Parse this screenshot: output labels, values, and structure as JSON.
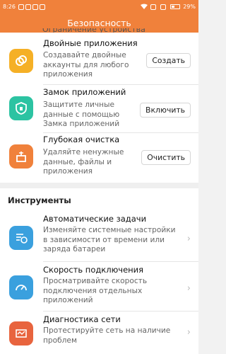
{
  "status": {
    "time": "8:26",
    "battery": "29%"
  },
  "header": {
    "title": "Безопасность"
  },
  "partial_text": "Ограничение устройства",
  "security_items": [
    {
      "title": "Двойные приложения",
      "desc": [
        "Создавайте двойные",
        "аккаунты для любого",
        "приложения"
      ],
      "button": "Создать",
      "icon": "dual-apps-icon",
      "color": "#f5b026"
    },
    {
      "title": "Замок приложений",
      "desc": [
        "Защитите личные",
        "данные с помощью",
        "Замка приложений"
      ],
      "button": "Включить",
      "icon": "app-lock-icon",
      "color": "#2cc3a2"
    },
    {
      "title": "Глубокая очистка",
      "desc": [
        "Удаляйте ненужные",
        "данные, файлы и",
        "приложения"
      ],
      "button": "Очистить",
      "icon": "deep-clean-icon",
      "color": "#f0813b"
    }
  ],
  "tools": {
    "heading": "Инструменты",
    "items": [
      {
        "title": "Автоматические задачи",
        "desc": [
          "Изменяйте системные настройки",
          "в зависимости от времени или",
          "заряда батареи"
        ],
        "icon": "auto-tasks-icon",
        "color": "#3aa0de"
      },
      {
        "title": "Скорость подключения",
        "desc": [
          "Просматривайте скорость",
          "подключения отдельных",
          "приложений"
        ],
        "icon": "speedometer-icon",
        "color": "#3aa0de"
      },
      {
        "title": "Диагностика сети",
        "desc": [
          "Протестируйте сеть на наличие",
          "проблем"
        ],
        "icon": "network-diagnostics-icon",
        "color": "#e8643e"
      }
    ]
  }
}
